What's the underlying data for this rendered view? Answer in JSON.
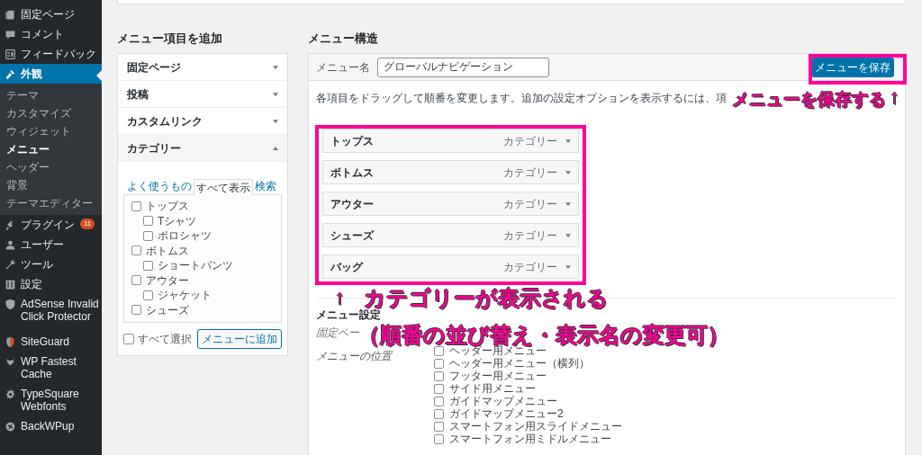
{
  "sidebar": {
    "items": [
      {
        "kind": "menu",
        "label": "固定ページ",
        "selected": false
      },
      {
        "kind": "menu",
        "label": "コメント",
        "selected": false
      },
      {
        "kind": "menu",
        "label": "フィードバック",
        "selected": false
      },
      {
        "kind": "menu",
        "label": "外観",
        "selected": true
      },
      {
        "kind": "sub",
        "label": "テーマ",
        "selected": false
      },
      {
        "kind": "sub",
        "label": "カスタマイズ",
        "selected": false
      },
      {
        "kind": "sub",
        "label": "ウィジェット",
        "selected": false
      },
      {
        "kind": "sub",
        "label": "メニュー",
        "selected": true
      },
      {
        "kind": "sub",
        "label": "ヘッダー",
        "selected": false
      },
      {
        "kind": "sub",
        "label": "背景",
        "selected": false
      },
      {
        "kind": "sub",
        "label": "テーマエディター",
        "selected": false
      },
      {
        "kind": "menu",
        "label": "プラグイン",
        "badge": "11",
        "selected": false
      },
      {
        "kind": "menu",
        "label": "ユーザー",
        "selected": false
      },
      {
        "kind": "menu",
        "label": "ツール",
        "selected": false
      },
      {
        "kind": "menu",
        "label": "設定",
        "selected": false
      },
      {
        "kind": "menu",
        "label": "AdSense Invalid Click Protector",
        "selected": false
      },
      {
        "kind": "menu",
        "label": "SiteGuard",
        "selected": false
      },
      {
        "kind": "menu",
        "label": "WP Fastest Cache",
        "selected": false
      },
      {
        "kind": "menu",
        "label": "TypeSquare Webfonts",
        "selected": false
      },
      {
        "kind": "menu",
        "label": "BackWPup",
        "selected": false
      }
    ]
  },
  "add_items": {
    "title": "メニュー項目を追加",
    "sections": [
      {
        "label": "固定ページ",
        "expanded": false
      },
      {
        "label": "投稿",
        "expanded": false
      },
      {
        "label": "カスタムリンク",
        "expanded": false
      },
      {
        "label": "カテゴリー",
        "expanded": true
      }
    ],
    "tabs": [
      {
        "label": "よく使うもの",
        "selected": false
      },
      {
        "label": "すべて表示",
        "selected": true
      },
      {
        "label": "検索",
        "selected": false
      }
    ],
    "categories": [
      {
        "label": "トップス",
        "checked": false,
        "children": [
          {
            "label": "Tシャツ",
            "checked": false
          },
          {
            "label": "ポロシャツ",
            "checked": false
          }
        ]
      },
      {
        "label": "ボトムス",
        "checked": false,
        "children": [
          {
            "label": "ショートパンツ",
            "checked": false
          }
        ]
      },
      {
        "label": "アウター",
        "checked": false,
        "children": [
          {
            "label": "ジャケット",
            "checked": false
          }
        ]
      },
      {
        "label": "シューズ",
        "checked": false
      }
    ],
    "select_all": {
      "label": "すべて選択",
      "checked": false
    },
    "add_button": "メニューに追加"
  },
  "structure": {
    "title": "メニュー構造",
    "name_label": "メニュー名",
    "name_value": "グローバルナビゲーション",
    "save_button": "メニューを保存",
    "description": "各項目をドラッグして順番を変更します。追加の設定オプションを表示するには、項",
    "items": [
      {
        "label": "トップス",
        "type": "カテゴリー"
      },
      {
        "label": "ボトムス",
        "type": "カテゴリー"
      },
      {
        "label": "アウター",
        "type": "カテゴリー"
      },
      {
        "label": "シューズ",
        "type": "カテゴリー"
      },
      {
        "label": "バッグ",
        "type": "カテゴリー"
      }
    ],
    "settings_title": "メニュー設定",
    "settings_note": "固定ペー",
    "location_label": "メニューの位置",
    "locations": [
      {
        "label": "ヘッダー用メニュー",
        "checked": false
      },
      {
        "label": "ヘッダー用メニュー（横列）",
        "checked": false
      },
      {
        "label": "フッター用メニュー",
        "checked": false
      },
      {
        "label": "サイド用メニュー",
        "checked": false
      },
      {
        "label": "ガイドマップメニュー",
        "checked": false
      },
      {
        "label": "ガイドマップメニュー2",
        "checked": false
      },
      {
        "label": "スマートフォン用スライドメニュー",
        "checked": false
      },
      {
        "label": "スマートフォン用ミドルメニュー",
        "checked": false
      }
    ]
  },
  "annotations": [
    {
      "text": "メニューを保存する"
    },
    {
      "text": "↑"
    },
    {
      "text": "↑"
    },
    {
      "text": "カテゴリーが表示される"
    },
    {
      "text": "（順番の並び替え・表示名の変更可）"
    }
  ]
}
